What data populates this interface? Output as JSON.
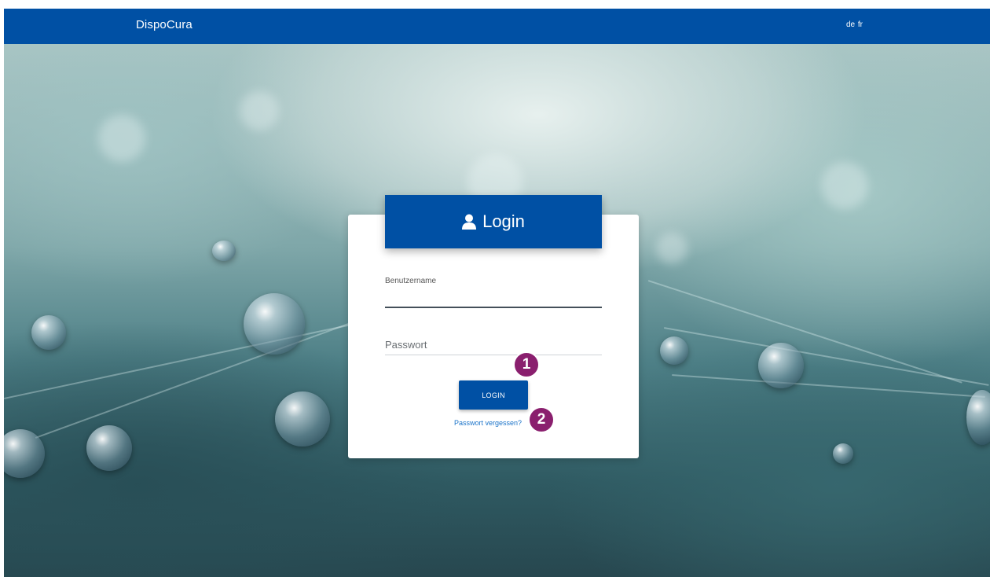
{
  "navbar": {
    "brand": "DispoCura",
    "languages": [
      "de",
      "fr"
    ]
  },
  "login_card": {
    "title": "Login",
    "username_label": "Benutzername",
    "username_value": "",
    "password_placeholder": "Passwort",
    "password_value": "",
    "submit_label": "LOGIN",
    "forgot_label": "Passwort vergessen?"
  },
  "markers": [
    {
      "label": "1"
    },
    {
      "label": "2"
    }
  ],
  "colors": {
    "brand": "#0050a4",
    "marker": "#8a1f6e",
    "link": "#1a73c9"
  },
  "icons": {
    "title_icon": "user-icon"
  }
}
